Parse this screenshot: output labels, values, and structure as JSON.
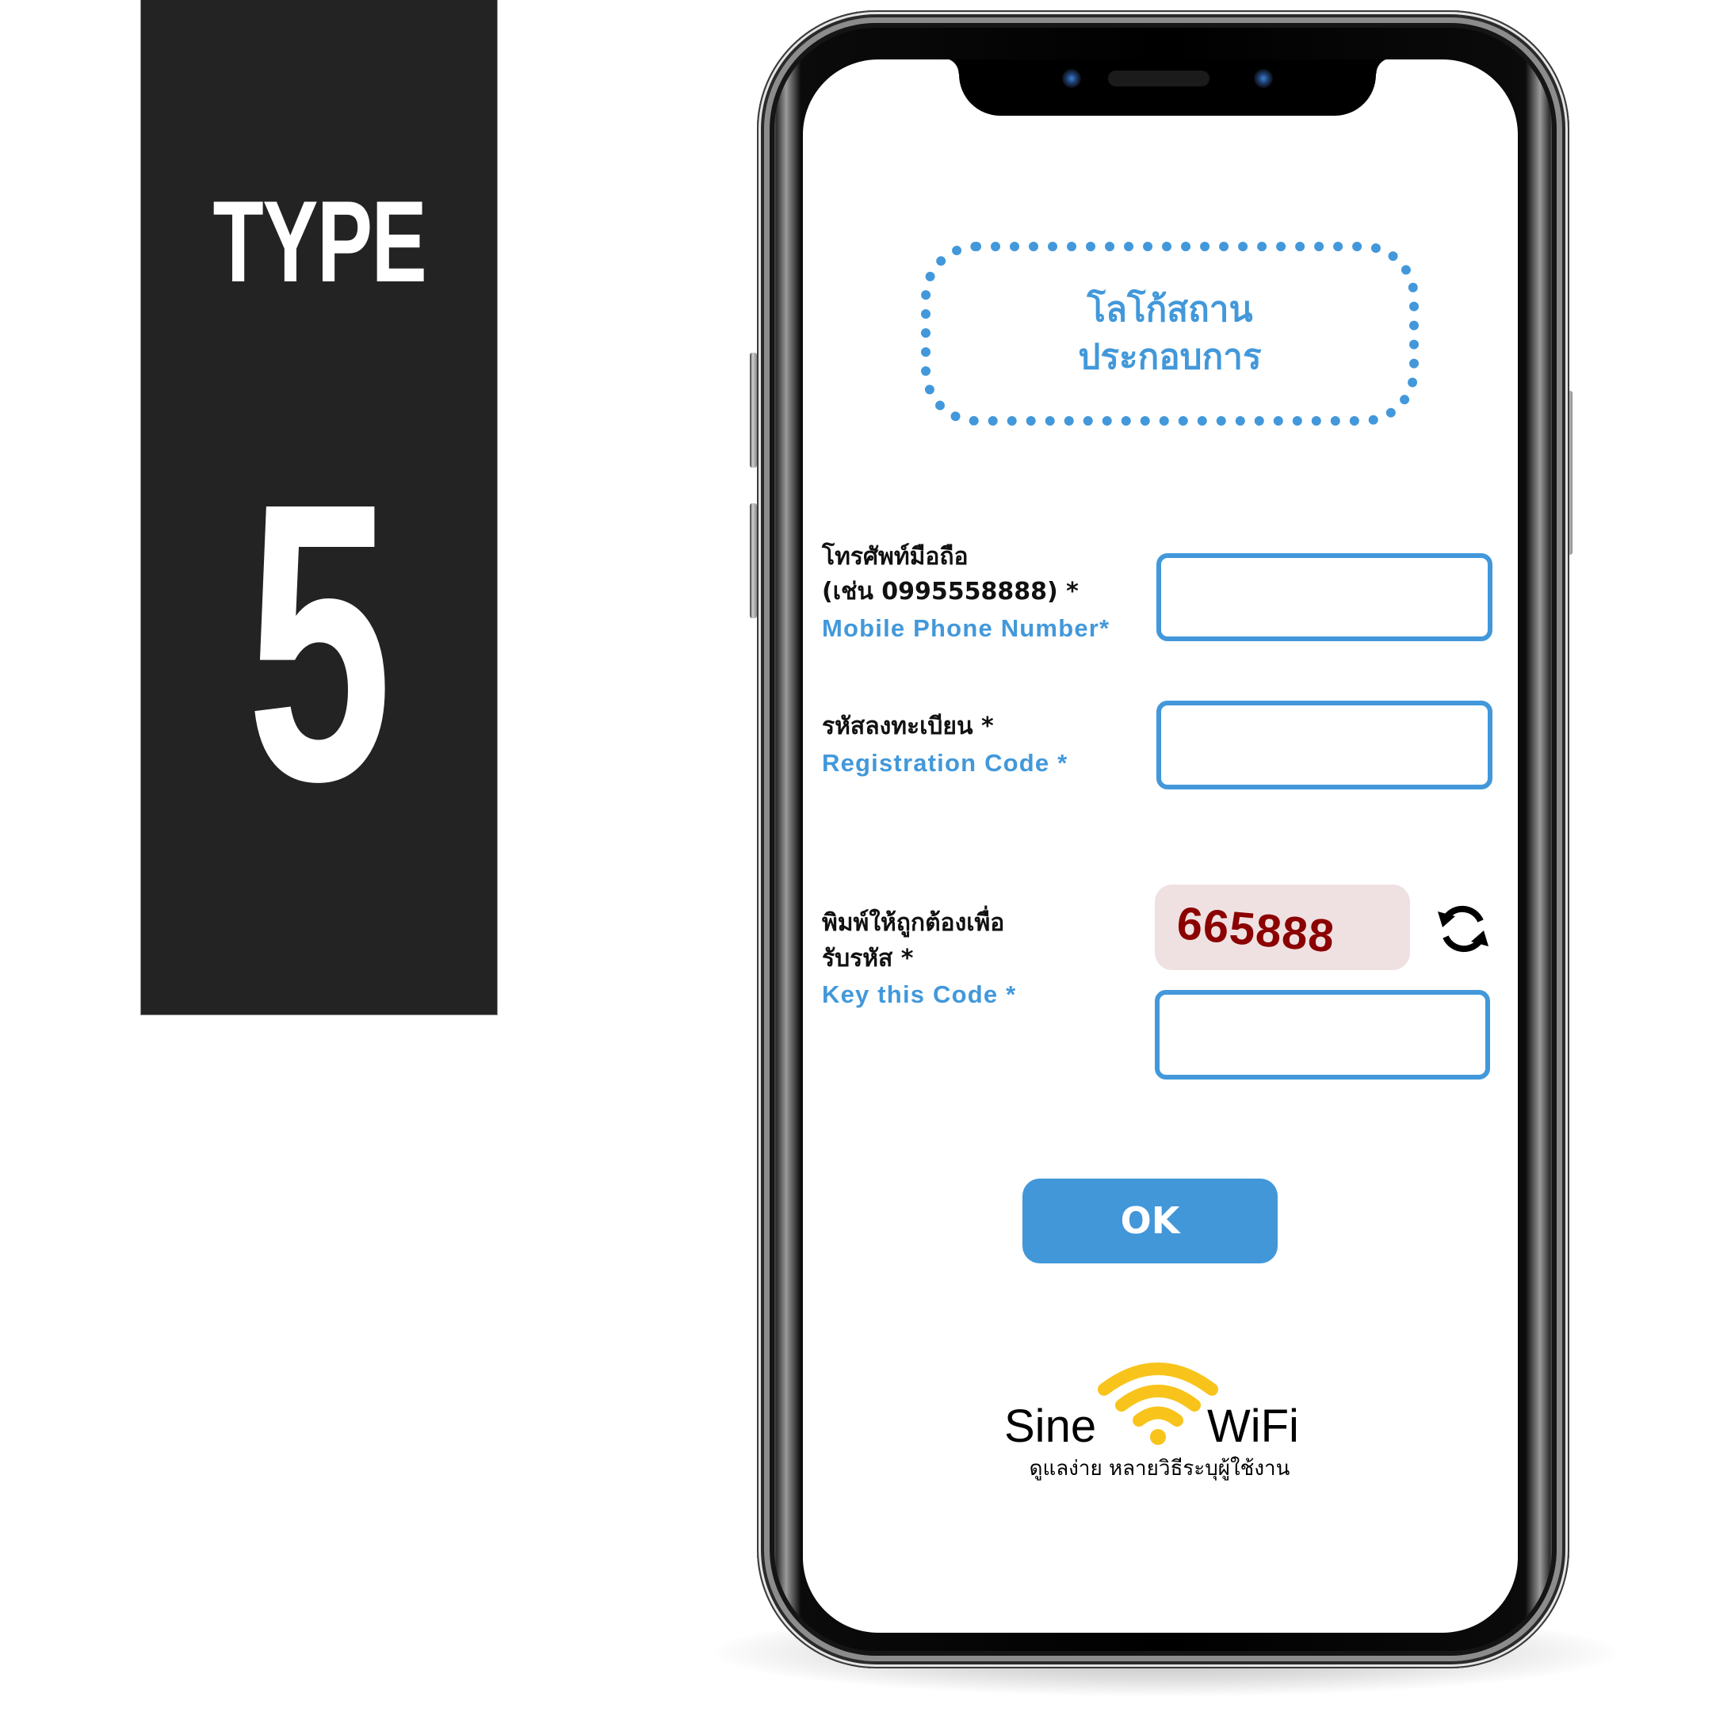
{
  "badge": {
    "label": "TYPE",
    "number": "5"
  },
  "phone": {
    "logo_placeholder": {
      "line1": "โลโก้สถาน",
      "line2": "ประกอบการ"
    },
    "form": {
      "phone_field": {
        "label_th_line1": "โทรศัพท์มือถือ",
        "label_th_line2": "(เช่น 0995558888) *",
        "label_en": "Mobile Phone Number*",
        "value": "",
        "placeholder": ""
      },
      "registration_field": {
        "label_th": "รหัสลงทะเบียน *",
        "label_en": "Registration Code *",
        "value": "",
        "placeholder": ""
      },
      "captcha_field": {
        "label_th_line1": "พิมพ์ให้ถูกต้องเพื่อ",
        "label_th_line2": "รับรหัส *",
        "label_en": "Key this Code *",
        "captcha_code": "665888",
        "refresh_icon": "refresh-icon",
        "value": "",
        "placeholder": ""
      },
      "submit_label": "OK"
    },
    "brand": {
      "name_left": "Sine",
      "name_right": "WiFi",
      "icon": "wifi-icon",
      "tagline": "ดูแลง่าย หลายวิธีระบุผู้ใช้งาน"
    }
  },
  "colors": {
    "accent_blue": "#4298DA",
    "captcha_bg": "#EFE1E2",
    "captcha_text": "#8B0000",
    "wifi_yellow": "#F8C41C",
    "panel_dark": "#232323"
  }
}
